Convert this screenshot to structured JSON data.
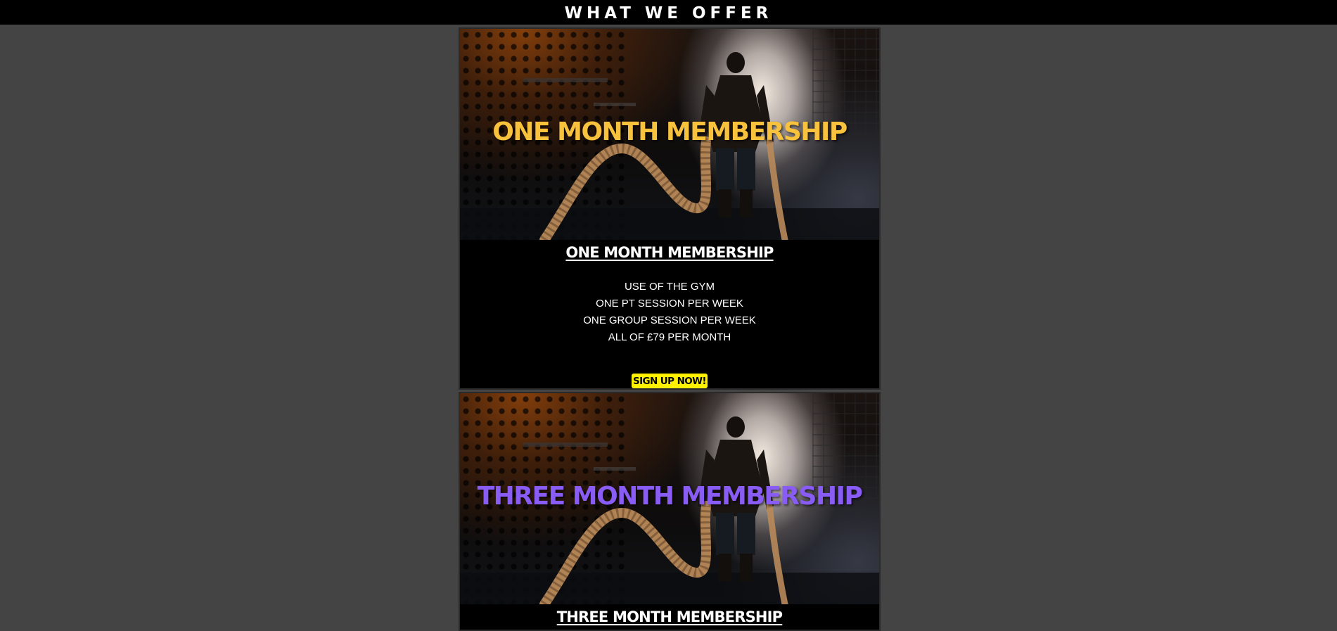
{
  "header": {
    "title": "WHAT WE OFFER"
  },
  "memberships": [
    {
      "banner_title": "ONE MONTH MEMBERSHIP",
      "banner_color": "#f9c23c",
      "heading": "ONE MONTH MEMBERSHIP",
      "features": [
        "USE OF THE GYM",
        "ONE PT SESSION PER WEEK",
        "ONE GROUP SESSION PER WEEK",
        "ALL OF £79 PER MONTH"
      ],
      "cta_label": "SIGN UP NOW!",
      "cta_color": "#fff200"
    },
    {
      "banner_title": "THREE MONTH MEMBERSHIP",
      "banner_color": "#8a5cf6",
      "heading": "THREE MONTH MEMBERSHIP"
    }
  ]
}
